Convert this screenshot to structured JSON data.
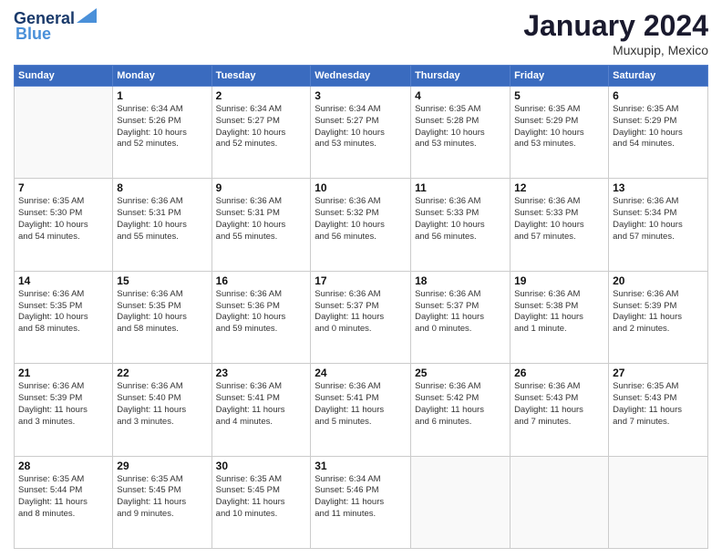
{
  "logo": {
    "line1": "General",
    "line2": "Blue"
  },
  "header": {
    "month": "January 2024",
    "location": "Muxupip, Mexico"
  },
  "weekdays": [
    "Sunday",
    "Monday",
    "Tuesday",
    "Wednesday",
    "Thursday",
    "Friday",
    "Saturday"
  ],
  "weeks": [
    [
      {
        "day": "",
        "info": ""
      },
      {
        "day": "1",
        "info": "Sunrise: 6:34 AM\nSunset: 5:26 PM\nDaylight: 10 hours\nand 52 minutes."
      },
      {
        "day": "2",
        "info": "Sunrise: 6:34 AM\nSunset: 5:27 PM\nDaylight: 10 hours\nand 52 minutes."
      },
      {
        "day": "3",
        "info": "Sunrise: 6:34 AM\nSunset: 5:27 PM\nDaylight: 10 hours\nand 53 minutes."
      },
      {
        "day": "4",
        "info": "Sunrise: 6:35 AM\nSunset: 5:28 PM\nDaylight: 10 hours\nand 53 minutes."
      },
      {
        "day": "5",
        "info": "Sunrise: 6:35 AM\nSunset: 5:29 PM\nDaylight: 10 hours\nand 53 minutes."
      },
      {
        "day": "6",
        "info": "Sunrise: 6:35 AM\nSunset: 5:29 PM\nDaylight: 10 hours\nand 54 minutes."
      }
    ],
    [
      {
        "day": "7",
        "info": "Sunrise: 6:35 AM\nSunset: 5:30 PM\nDaylight: 10 hours\nand 54 minutes."
      },
      {
        "day": "8",
        "info": "Sunrise: 6:36 AM\nSunset: 5:31 PM\nDaylight: 10 hours\nand 55 minutes."
      },
      {
        "day": "9",
        "info": "Sunrise: 6:36 AM\nSunset: 5:31 PM\nDaylight: 10 hours\nand 55 minutes."
      },
      {
        "day": "10",
        "info": "Sunrise: 6:36 AM\nSunset: 5:32 PM\nDaylight: 10 hours\nand 56 minutes."
      },
      {
        "day": "11",
        "info": "Sunrise: 6:36 AM\nSunset: 5:33 PM\nDaylight: 10 hours\nand 56 minutes."
      },
      {
        "day": "12",
        "info": "Sunrise: 6:36 AM\nSunset: 5:33 PM\nDaylight: 10 hours\nand 57 minutes."
      },
      {
        "day": "13",
        "info": "Sunrise: 6:36 AM\nSunset: 5:34 PM\nDaylight: 10 hours\nand 57 minutes."
      }
    ],
    [
      {
        "day": "14",
        "info": "Sunrise: 6:36 AM\nSunset: 5:35 PM\nDaylight: 10 hours\nand 58 minutes."
      },
      {
        "day": "15",
        "info": "Sunrise: 6:36 AM\nSunset: 5:35 PM\nDaylight: 10 hours\nand 58 minutes."
      },
      {
        "day": "16",
        "info": "Sunrise: 6:36 AM\nSunset: 5:36 PM\nDaylight: 10 hours\nand 59 minutes."
      },
      {
        "day": "17",
        "info": "Sunrise: 6:36 AM\nSunset: 5:37 PM\nDaylight: 11 hours\nand 0 minutes."
      },
      {
        "day": "18",
        "info": "Sunrise: 6:36 AM\nSunset: 5:37 PM\nDaylight: 11 hours\nand 0 minutes."
      },
      {
        "day": "19",
        "info": "Sunrise: 6:36 AM\nSunset: 5:38 PM\nDaylight: 11 hours\nand 1 minute."
      },
      {
        "day": "20",
        "info": "Sunrise: 6:36 AM\nSunset: 5:39 PM\nDaylight: 11 hours\nand 2 minutes."
      }
    ],
    [
      {
        "day": "21",
        "info": "Sunrise: 6:36 AM\nSunset: 5:39 PM\nDaylight: 11 hours\nand 3 minutes."
      },
      {
        "day": "22",
        "info": "Sunrise: 6:36 AM\nSunset: 5:40 PM\nDaylight: 11 hours\nand 3 minutes."
      },
      {
        "day": "23",
        "info": "Sunrise: 6:36 AM\nSunset: 5:41 PM\nDaylight: 11 hours\nand 4 minutes."
      },
      {
        "day": "24",
        "info": "Sunrise: 6:36 AM\nSunset: 5:41 PM\nDaylight: 11 hours\nand 5 minutes."
      },
      {
        "day": "25",
        "info": "Sunrise: 6:36 AM\nSunset: 5:42 PM\nDaylight: 11 hours\nand 6 minutes."
      },
      {
        "day": "26",
        "info": "Sunrise: 6:36 AM\nSunset: 5:43 PM\nDaylight: 11 hours\nand 7 minutes."
      },
      {
        "day": "27",
        "info": "Sunrise: 6:35 AM\nSunset: 5:43 PM\nDaylight: 11 hours\nand 7 minutes."
      }
    ],
    [
      {
        "day": "28",
        "info": "Sunrise: 6:35 AM\nSunset: 5:44 PM\nDaylight: 11 hours\nand 8 minutes."
      },
      {
        "day": "29",
        "info": "Sunrise: 6:35 AM\nSunset: 5:45 PM\nDaylight: 11 hours\nand 9 minutes."
      },
      {
        "day": "30",
        "info": "Sunrise: 6:35 AM\nSunset: 5:45 PM\nDaylight: 11 hours\nand 10 minutes."
      },
      {
        "day": "31",
        "info": "Sunrise: 6:34 AM\nSunset: 5:46 PM\nDaylight: 11 hours\nand 11 minutes."
      },
      {
        "day": "",
        "info": ""
      },
      {
        "day": "",
        "info": ""
      },
      {
        "day": "",
        "info": ""
      }
    ]
  ]
}
